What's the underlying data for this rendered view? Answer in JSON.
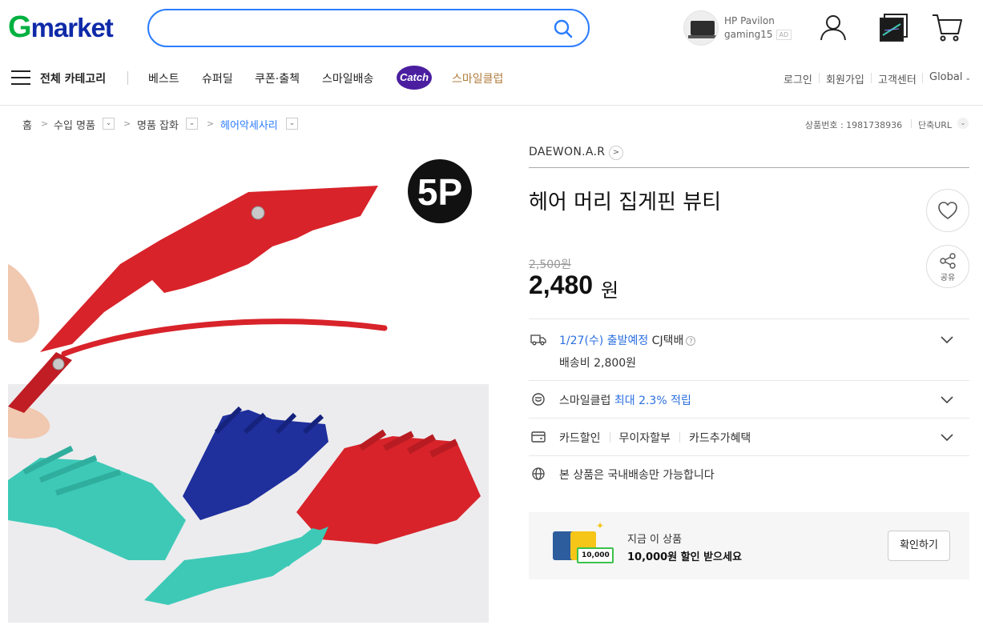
{
  "header": {
    "logo_g": "G",
    "logo_rest": "market",
    "search_placeholder": "",
    "ad_title": "HP Pavilon",
    "ad_subtitle": "gaming15",
    "ad_badge": "AD"
  },
  "nav": {
    "all_categories": "전체 카테고리",
    "items": [
      "베스트",
      "슈퍼딜",
      "쿠폰·출첵",
      "스마일배송"
    ],
    "catch": "Catch",
    "smile_club": "스마일클럽",
    "right": [
      "로그인",
      "회원가입",
      "고객센터",
      "Global"
    ]
  },
  "breadcrumb": {
    "home": "홈",
    "levels": [
      "수입 명품",
      "명품 잡화",
      "헤어악세사리"
    ],
    "product_no": "상품번호 : 1981738936",
    "short_url": "단축URL"
  },
  "product": {
    "image_badge": "5P",
    "brand": "DAEWON.A.R",
    "title": "헤어 머리 집게핀 뷰티",
    "original_price": "2,500원",
    "price": "2,480",
    "price_unit": "원",
    "share_label": "공유"
  },
  "shipping": {
    "date": "1/27(수) 출발예정",
    "carrier": "CJ택배",
    "fee": "배송비 2,800원"
  },
  "smile": {
    "label": "스마일클럽",
    "reward": "최대 2.3% 적립"
  },
  "card": {
    "items": [
      "카드할인",
      "무이자할부",
      "카드추가혜택"
    ]
  },
  "domestic": {
    "text": "본 상품은 국내배송만 가능합니다"
  },
  "promo": {
    "bill_value": "10,000",
    "line1": "지금 이 상품",
    "line2": "10,000원 할인 받으세요",
    "button": "확인하기"
  },
  "colors": {
    "accent_blue": "#2b7dff",
    "logo_green": "#00b140",
    "logo_navy": "#0f2aa8",
    "catch_purple": "#4b1ea0",
    "smile_gold": "#b07b3c",
    "clip_red": "#d8232a",
    "clip_blue": "#1f2f9c",
    "clip_mint": "#3ec9b7"
  }
}
